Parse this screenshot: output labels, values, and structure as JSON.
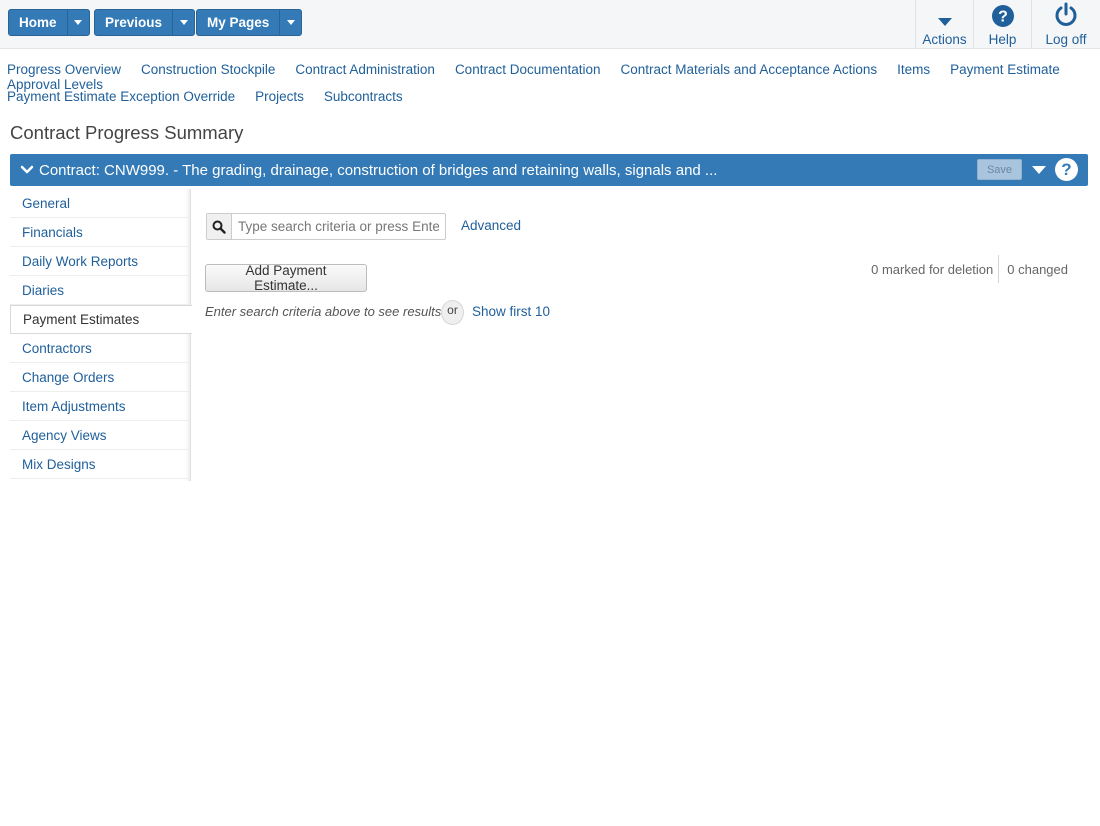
{
  "topbar": {
    "nav_buttons": [
      {
        "label": "Home"
      },
      {
        "label": "Previous"
      },
      {
        "label": "My Pages"
      }
    ],
    "tools": [
      {
        "label": "Actions",
        "icon": "caret-down-icon"
      },
      {
        "label": "Help",
        "icon": "help-icon"
      },
      {
        "label": "Log off",
        "icon": "power-icon"
      }
    ]
  },
  "links": {
    "row1": [
      "Progress Overview",
      "Construction Stockpile",
      "Contract Administration",
      "Contract Documentation",
      "Contract Materials and Acceptance Actions",
      "Items",
      "Payment Estimate Approval Levels"
    ],
    "row2": [
      "Payment Estimate Exception Override",
      "Projects",
      "Subcontracts"
    ]
  },
  "page": {
    "title": "Contract Progress Summary"
  },
  "contract": {
    "title": "Contract: CNW999. - The grading, drainage, construction of bridges and retaining walls, signals and ...",
    "save_label": "Save"
  },
  "sidebar": {
    "items": [
      {
        "label": "General"
      },
      {
        "label": "Financials"
      },
      {
        "label": "Daily Work Reports"
      },
      {
        "label": "Diaries"
      },
      {
        "label": "Payment Estimates"
      },
      {
        "label": "Contractors"
      },
      {
        "label": "Change Orders"
      },
      {
        "label": "Item Adjustments"
      },
      {
        "label": "Agency Views"
      },
      {
        "label": "Mix Designs"
      }
    ],
    "active_index": 4
  },
  "main": {
    "search_placeholder": "Type search criteria or press Enter",
    "search_value": "",
    "advanced_label": "Advanced",
    "add_button_label": "Add Payment Estimate...",
    "marked_for_deletion": "0 marked for deletion",
    "changed": "0 changed",
    "hint": "Enter search criteria above to see results",
    "or_label": "or",
    "show_first_label": "Show first 10"
  },
  "colors": {
    "primary": "#337ab7",
    "link": "#1f5f9a"
  }
}
